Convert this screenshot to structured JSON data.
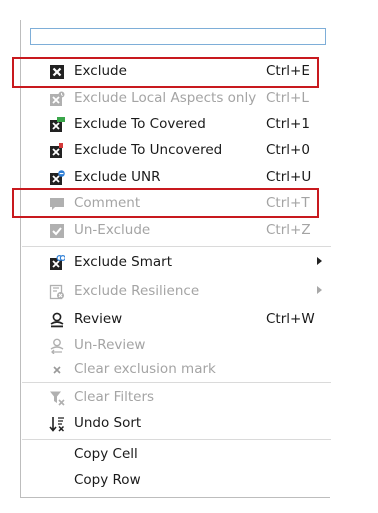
{
  "search": {
    "placeholder": "",
    "value": ""
  },
  "items": [
    {
      "label": "Exclude",
      "shortcut": "Ctrl+E",
      "icon": "exclude-icon",
      "enabled": true
    },
    {
      "label": "Exclude Local Aspects only",
      "shortcut": "Ctrl+L",
      "icon": "exclude-local-icon",
      "enabled": false
    },
    {
      "label": "Exclude To Covered",
      "shortcut": "Ctrl+1",
      "icon": "exclude-covered-icon",
      "enabled": true
    },
    {
      "label": "Exclude To Uncovered",
      "shortcut": "Ctrl+0",
      "icon": "exclude-uncovered-icon",
      "enabled": true
    },
    {
      "label": "Exclude UNR",
      "shortcut": "Ctrl+U",
      "icon": "exclude-unr-icon",
      "enabled": true
    },
    {
      "label": "Comment",
      "shortcut": "Ctrl+T",
      "icon": "comment-icon",
      "enabled": false
    },
    {
      "label": "Un-Exclude",
      "shortcut": "Ctrl+Z",
      "icon": "un-exclude-icon",
      "enabled": false
    },
    {
      "label": "Exclude Smart",
      "shortcut": "",
      "icon": "exclude-smart-icon",
      "enabled": true,
      "submenu": true
    },
    {
      "label": "Exclude Resilience",
      "shortcut": "",
      "icon": "exclude-resilience-icon",
      "enabled": false,
      "submenu": true
    },
    {
      "label": "Review",
      "shortcut": "Ctrl+W",
      "icon": "review-icon",
      "enabled": true
    },
    {
      "label": "Un-Review",
      "shortcut": "",
      "icon": "un-review-icon",
      "enabled": false
    },
    {
      "label": "Clear exclusion mark",
      "shortcut": "",
      "icon": "clear-mark-icon",
      "enabled": false
    },
    {
      "label": "Clear Filters",
      "shortcut": "",
      "icon": "clear-filters-icon",
      "enabled": false
    },
    {
      "label": "Undo Sort",
      "shortcut": "",
      "icon": "undo-sort-icon",
      "enabled": true
    },
    {
      "label": "Copy Cell",
      "shortcut": "",
      "icon": "",
      "enabled": true
    },
    {
      "label": "Copy Row",
      "shortcut": "",
      "icon": "",
      "enabled": true
    }
  ],
  "colors": {
    "highlight": "#c8191e",
    "disabled_text": "#a4a4a4",
    "search_border": "#7eaed8"
  }
}
